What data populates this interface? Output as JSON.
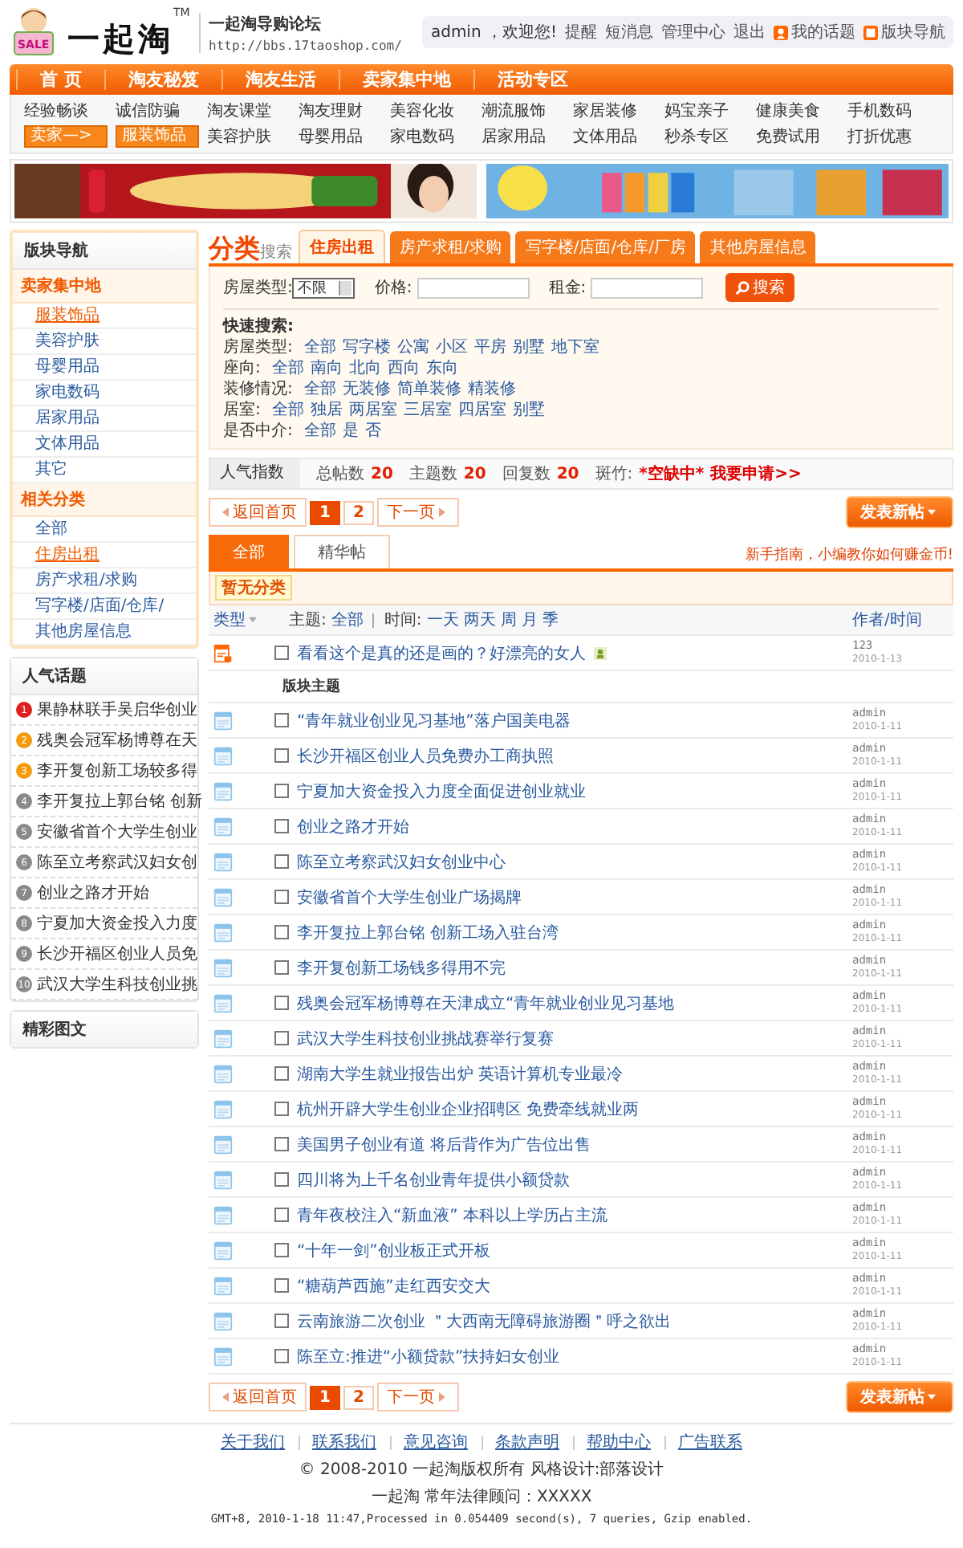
{
  "header": {
    "logo_badge": "SALE",
    "logo_text": "一起淘",
    "tm": "TM",
    "site_title": "一起淘导购论坛",
    "url": "http://bbs.17taoshop.com/",
    "welcome": "admin ，欢迎您!",
    "user_links": [
      "提醒",
      "短消息",
      "管理中心",
      "退出"
    ],
    "my_topics": "我的话题",
    "board_nav": "版块导航"
  },
  "main_nav": [
    "首 页",
    "淘友秘笈",
    "淘友生活",
    "卖家集中地",
    "活动专区"
  ],
  "sub_nav": [
    [
      {
        "kind": "link",
        "label": "经验畅谈"
      },
      {
        "kind": "link",
        "label": "诚信防骗"
      },
      {
        "kind": "link",
        "label": "淘友课堂"
      },
      {
        "kind": "link",
        "label": "淘友理财"
      },
      {
        "kind": "link",
        "label": "美容化妆"
      },
      {
        "kind": "link",
        "label": "潮流服饰"
      },
      {
        "kind": "link",
        "label": "家居装修"
      },
      {
        "kind": "link",
        "label": "妈宝亲子"
      },
      {
        "kind": "link",
        "label": "健康美食"
      },
      {
        "kind": "link",
        "label": "手机数码"
      }
    ],
    [
      {
        "kind": "badge",
        "label": "卖家—>"
      },
      {
        "kind": "badge",
        "label": "服装饰品"
      },
      {
        "kind": "link",
        "label": "美容护肤"
      },
      {
        "kind": "link",
        "label": "母婴用品"
      },
      {
        "kind": "link",
        "label": "家电数码"
      },
      {
        "kind": "link",
        "label": "居家用品"
      },
      {
        "kind": "link",
        "label": "文体用品"
      },
      {
        "kind": "link",
        "label": "秒杀专区"
      },
      {
        "kind": "link",
        "label": "免费试用"
      },
      {
        "kind": "link",
        "label": "打折优惠"
      }
    ]
  ],
  "sidebar": {
    "title": "版块导航",
    "sections": [
      {
        "title": "卖家集中地",
        "items": [
          {
            "label": "服装饰品",
            "selected": true
          },
          {
            "label": "美容护肤",
            "selected": false
          },
          {
            "label": "母婴用品",
            "selected": false
          },
          {
            "label": "家电数码",
            "selected": false
          },
          {
            "label": "居家用品",
            "selected": false
          },
          {
            "label": "文体用品",
            "selected": false
          },
          {
            "label": "其它",
            "selected": false
          }
        ]
      },
      {
        "title": "相关分类",
        "items": [
          {
            "label": "全部",
            "selected": false
          },
          {
            "label": "住房出租",
            "selected": true
          },
          {
            "label": "房产求租/求购",
            "selected": false
          },
          {
            "label": "写字楼/店面/仓库/",
            "selected": false
          },
          {
            "label": "其他房屋信息",
            "selected": false
          }
        ]
      }
    ]
  },
  "hot_topics": {
    "title": "人气话题",
    "items": [
      {
        "rank": "1",
        "text": "果静林联手吴启华创业",
        "color": "#e02020"
      },
      {
        "rank": "2",
        "text": "残奥会冠军杨博尊在天",
        "color": "#f59a0c"
      },
      {
        "rank": "3",
        "text": "李开复创新工场较多得",
        "color": "#f59a0c"
      },
      {
        "rank": "4",
        "text": "李开复拉上郭台铭 创新",
        "color": "#8a8a8a"
      },
      {
        "rank": "5",
        "text": "安徽省首个大学生创业",
        "color": "#8a8a8a"
      },
      {
        "rank": "6",
        "text": "陈至立考察武汉妇女创",
        "color": "#8a8a8a"
      },
      {
        "rank": "7",
        "text": "创业之路才开始",
        "color": "#8a8a8a"
      },
      {
        "rank": "8",
        "text": "宁夏加大资金投入力度",
        "color": "#8a8a8a"
      },
      {
        "rank": "9",
        "text": "长沙开福区创业人员免",
        "color": "#8a8a8a"
      },
      {
        "rank": "10",
        "text": "武汉大学生科技创业挑",
        "color": "#8a8a8a"
      }
    ]
  },
  "featured": {
    "title": "精彩图文"
  },
  "category": {
    "title": "分类",
    "subtitle": "搜索",
    "tabs": [
      {
        "label": "住房出租",
        "selected": true
      },
      {
        "label": "房产求租/求购",
        "selected": false
      },
      {
        "label": "写字楼/店面/仓库/厂房",
        "selected": false
      },
      {
        "label": "其他房屋信息",
        "selected": false
      }
    ]
  },
  "search": {
    "type_label": "房屋类型:",
    "type_value": "不限",
    "price_label": "价格:",
    "rent_label": "租金:",
    "button": "搜索"
  },
  "quick_search": {
    "title": "快速搜索:",
    "rows": [
      {
        "label": "房屋类型:",
        "options": [
          "全部",
          "写字楼",
          "公寓",
          "小区",
          "平房",
          "别墅",
          "地下室"
        ]
      },
      {
        "label": "座向:",
        "options": [
          "全部",
          "南向",
          "北向",
          "西向",
          "东向"
        ]
      },
      {
        "label": "装修情况:",
        "options": [
          "全部",
          "无装修",
          "简单装修",
          "精装修"
        ]
      },
      {
        "label": "居室:",
        "options": [
          "全部",
          "独居",
          "两居室",
          "三居室",
          "四居室",
          "别墅"
        ]
      },
      {
        "label": "是否中介:",
        "options": [
          "全部",
          "是",
          "否"
        ]
      }
    ]
  },
  "stats": {
    "title": "人气指数",
    "items": [
      {
        "label": "总帖数",
        "value": "20"
      },
      {
        "label": "主题数",
        "value": "20"
      },
      {
        "label": "回复数",
        "value": "20"
      }
    ],
    "moderator_label": "斑竹:",
    "moderator": "*空缺中*",
    "apply": "我要申请>>"
  },
  "pager_top": {
    "home": "返回首页",
    "pages": [
      {
        "label": "1",
        "selected": true
      },
      {
        "label": "2",
        "selected": false
      }
    ],
    "next": "下一页",
    "post": "发表新帖"
  },
  "thread_tabs": [
    {
      "label": "全部",
      "selected": true
    },
    {
      "label": "精华帖",
      "selected": false
    }
  ],
  "notice": "新手指南，小编教你如何赚金币!",
  "category_tag": "暂无分类",
  "list_header": {
    "type": "类型",
    "subject_label": "主题:",
    "subject_filter": "全部",
    "time_label": "时间:",
    "time_options": [
      "一天",
      "两天",
      "周",
      "月",
      "季"
    ],
    "author": "作者/时间"
  },
  "sticky": [
    {
      "title": "看看这个是真的还是画的？好漂亮的女人",
      "author": "123",
      "date": "2010-1-13",
      "checked": false
    }
  ],
  "section_label": "版块主题",
  "threads": [
    {
      "title": "“青年就业创业见习基地”落户国美电器",
      "author": "admin",
      "date": "2010-1-11",
      "checked": false
    },
    {
      "title": "长沙开福区创业人员免费办工商执照",
      "author": "admin",
      "date": "2010-1-11",
      "checked": false
    },
    {
      "title": "宁夏加大资金投入力度全面促进创业就业",
      "author": "admin",
      "date": "2010-1-11",
      "checked": false
    },
    {
      "title": "创业之路才开始",
      "author": "admin",
      "date": "2010-1-11",
      "checked": false
    },
    {
      "title": "陈至立考察武汉妇女创业中心",
      "author": "admin",
      "date": "2010-1-11",
      "checked": false
    },
    {
      "title": "安徽省首个大学生创业广场揭牌",
      "author": "admin",
      "date": "2010-1-11",
      "checked": false
    },
    {
      "title": "李开复拉上郭台铭 创新工场入驻台湾",
      "author": "admin",
      "date": "2010-1-11",
      "checked": false
    },
    {
      "title": "李开复创新工场钱多得用不完",
      "author": "admin",
      "date": "2010-1-11",
      "checked": false
    },
    {
      "title": "残奥会冠军杨博尊在天津成立“青年就业创业见习基地",
      "author": "admin",
      "date": "2010-1-11",
      "checked": false
    },
    {
      "title": "武汉大学生科技创业挑战赛举行复赛",
      "author": "admin",
      "date": "2010-1-11",
      "checked": false
    },
    {
      "title": "湖南大学生就业报告出炉 英语计算机专业最冷",
      "author": "admin",
      "date": "2010-1-11",
      "checked": false
    },
    {
      "title": "杭州开辟大学生创业企业招聘区 免费牵线就业两",
      "author": "admin",
      "date": "2010-1-11",
      "checked": false
    },
    {
      "title": "美国男子创业有道 将后背作为广告位出售",
      "author": "admin",
      "date": "2010-1-11",
      "checked": false
    },
    {
      "title": "四川将为上千名创业青年提供小额贷款",
      "author": "admin",
      "date": "2010-1-11",
      "checked": false
    },
    {
      "title": "青年夜校注入“新血液” 本科以上学历占主流",
      "author": "admin",
      "date": "2010-1-11",
      "checked": false
    },
    {
      "title": "“十年一剑”创业板正式开板",
      "author": "admin",
      "date": "2010-1-11",
      "checked": false
    },
    {
      "title": "“糖葫芦西施”走红西安交大",
      "author": "admin",
      "date": "2010-1-11",
      "checked": false
    },
    {
      "title": "云南旅游二次创业 ＂大西南无障碍旅游圈＂呼之欲出",
      "author": "admin",
      "date": "2010-1-11",
      "checked": false
    },
    {
      "title": "陈至立:推进“小额贷款”扶持妇女创业",
      "author": "admin",
      "date": "2010-1-11",
      "checked": false
    }
  ],
  "pager_bottom": {
    "home": "返回首页",
    "pages": [
      {
        "label": "1",
        "selected": true
      },
      {
        "label": "2",
        "selected": false
      }
    ],
    "next": "下一页",
    "post": "发表新帖"
  },
  "footer": {
    "links": [
      "关于我们",
      "联系我们",
      "意见咨询",
      "条款声明",
      "帮助中心",
      "广告联系"
    ],
    "copyright": "© 2008-2010 一起淘版权所有 风格设计:部落设计",
    "legal": "一起淘 常年法律顾问：XXXXX",
    "debug": "GMT+8, 2010-1-18 11:47,Processed in 0.054409 second(s), 7 queries, Gzip enabled."
  }
}
